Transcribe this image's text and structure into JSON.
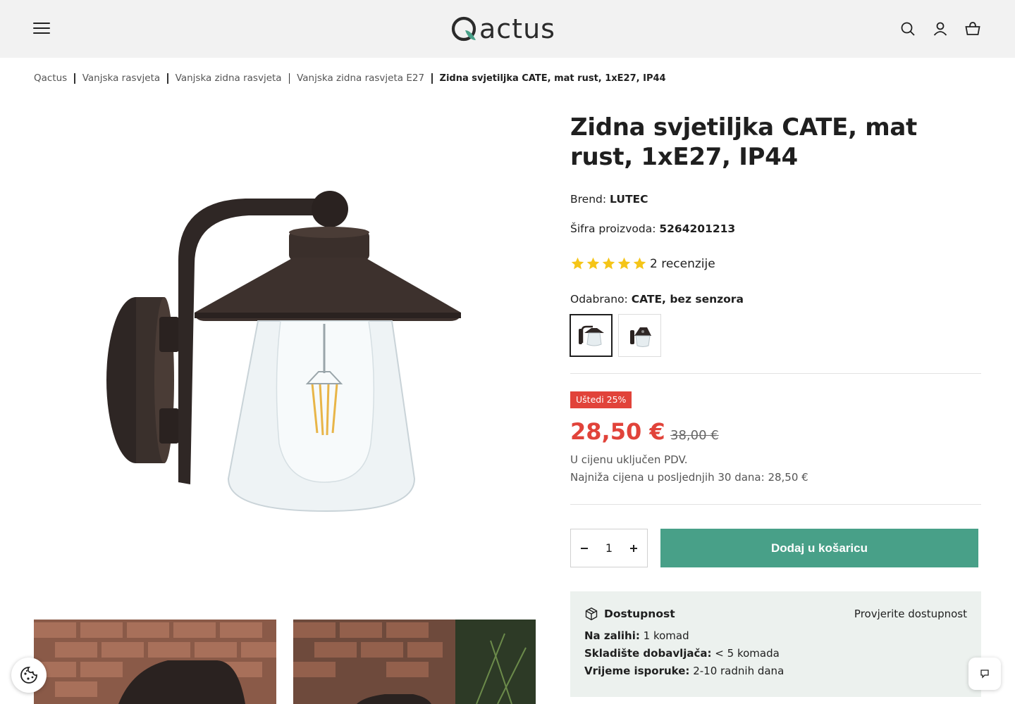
{
  "header": {
    "logo_text": "actus",
    "icons": [
      "menu-icon",
      "search-icon",
      "account-icon",
      "cart-icon"
    ]
  },
  "breadcrumb": {
    "items": [
      "Qactus",
      "Vanjska rasvjeta",
      "Vanjska zidna rasvjeta",
      "Vanjska zidna rasvjeta E27"
    ],
    "current": "Zidna svjetiljka CATE, mat rust, 1xE27, IP44"
  },
  "product": {
    "title": "Zidna svjetiljka CATE, mat rust, 1xE27, IP44",
    "brand_label": "Brend:",
    "brand": "LUTEC",
    "sku_label": "Šifra proizvoda:",
    "sku": "5264201213",
    "rating": 5,
    "reviews": "2 recenzije",
    "selected_label": "Odabrano:",
    "selected": "CATE, bez senzora",
    "badge": "Uštedi 25%",
    "price": "28,50 €",
    "old_price": "38,00 €",
    "vat_note": "U cijenu uključen PDV.",
    "lowest_price_note": "Najniža cijena u posljednjih 30 dana: 28,50 €",
    "quantity": "1",
    "add_to_cart": "Dodaj u košaricu"
  },
  "availability": {
    "title": "Dostupnost",
    "check_link": "Provjerite dostupnost",
    "in_stock_label": "Na zalihi:",
    "in_stock": "1 komad",
    "supplier_label": "Skladište dobavljača:",
    "supplier": "< 5 komada",
    "delivery_label": "Vrijeme isporuke:",
    "delivery": "2-10 radnih dana"
  },
  "colors": {
    "accent": "#48a088",
    "sale": "#e1433a",
    "star": "#f5c518",
    "header_bg": "#f2f2f2",
    "availability_bg": "#ecf1ee"
  }
}
